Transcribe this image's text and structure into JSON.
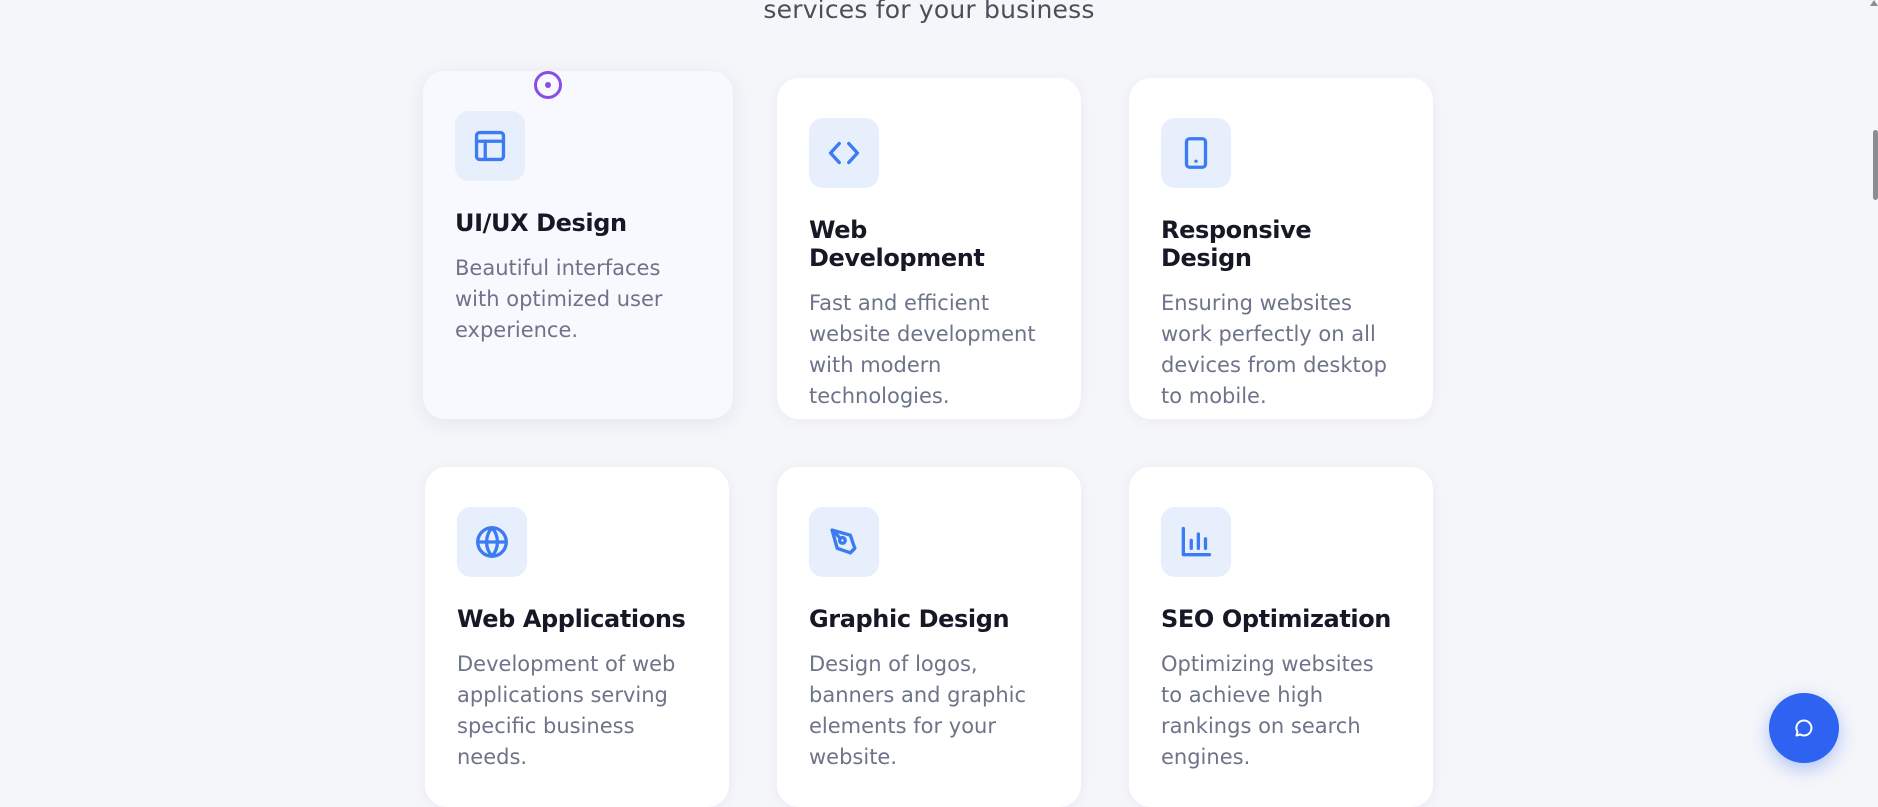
{
  "section": {
    "subtitle": "services for your business"
  },
  "services": [
    {
      "title": "UI/UX Design",
      "description": "Beautiful interfaces with optimized user experience.",
      "icon": "layout-icon"
    },
    {
      "title": "Web Development",
      "description": "Fast and efficient website development with modern technologies.",
      "icon": "code-icon"
    },
    {
      "title": "Responsive Design",
      "description": "Ensuring websites work perfectly on all devices from desktop to mobile.",
      "icon": "tablet-icon"
    },
    {
      "title": "Web Applications",
      "description": "Development of web applications serving specific business needs.",
      "icon": "globe-icon"
    },
    {
      "title": "Graphic Design",
      "description": "Design of logos, banners and graphic elements for your website.",
      "icon": "pen-tool-icon"
    },
    {
      "title": "SEO Optimization",
      "description": "Optimizing websites to achieve high rankings on search engines.",
      "icon": "bar-chart-icon"
    }
  ],
  "chat_button": {
    "icon": "chat-icon"
  },
  "colors": {
    "background": "#f5f6fa",
    "card": "#ffffff",
    "icon_bg": "#e7eefc",
    "icon_stroke": "#3b7cf3",
    "title": "#161826",
    "description": "#6d7489",
    "chat_button": "#2d63f0",
    "cursor": "#8a4ce8"
  }
}
